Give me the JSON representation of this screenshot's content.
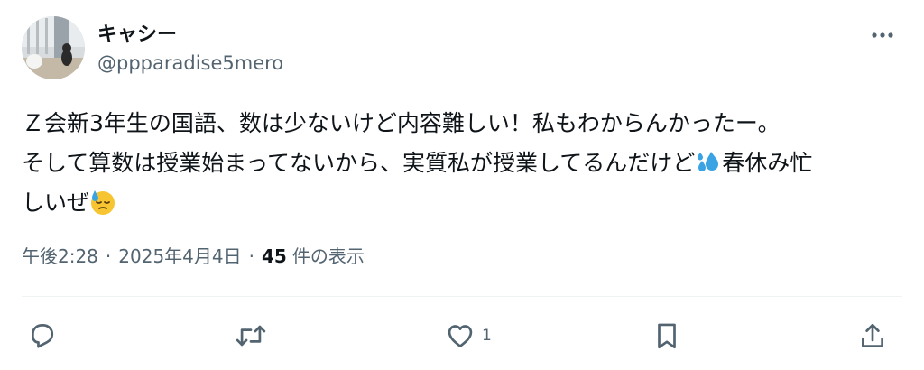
{
  "author": {
    "display_name": "キャシー",
    "handle": "@ppparadise5mero"
  },
  "tweet": {
    "line1": "Ｚ会新3年生の国語、数は少ないけど内容難しい！私もわからんかったー。",
    "line2_before_emoji": "そして算数は授業始まってないから、実質私が授業してるんだけど",
    "line2_after_emoji": "春休み忙",
    "line3": "しいぜ",
    "emojis": [
      "sweat-droplets-emoji",
      "downcast-face-with-sweat-emoji"
    ]
  },
  "meta": {
    "time": "午後2:28",
    "separator": "·",
    "date": "2025年4月4日",
    "views_count": "45",
    "views_label": "件の表示"
  },
  "actions": {
    "reply_icon": "reply-icon",
    "retweet_icon": "retweet-icon",
    "like_icon": "heart-icon",
    "like_count": "1",
    "bookmark_icon": "bookmark-icon",
    "share_icon": "share-icon"
  },
  "colors": {
    "text": "#0f1419",
    "secondary": "#536471",
    "divider": "#eff3f4",
    "background": "#ffffff"
  }
}
